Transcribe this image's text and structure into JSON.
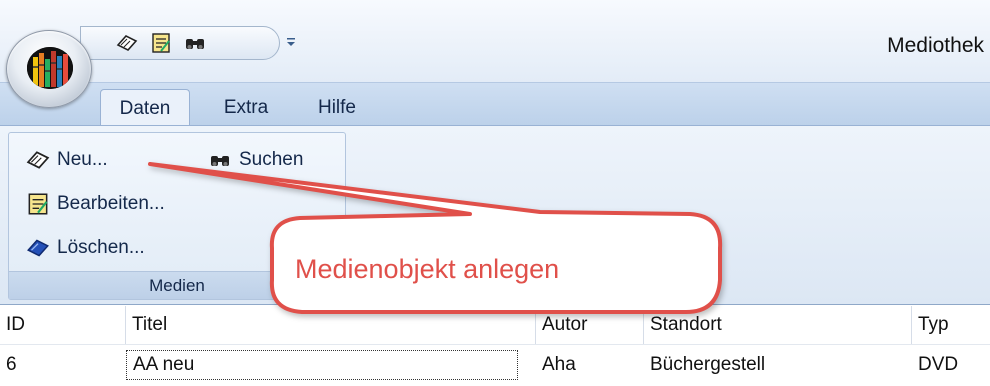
{
  "app": {
    "title": "Mediothek"
  },
  "quick_access": {
    "buttons": [
      {
        "name": "new-media-icon"
      },
      {
        "name": "edit-media-icon"
      },
      {
        "name": "binoculars-icon"
      }
    ],
    "dropdown_glyph": "⩡"
  },
  "tabs": [
    {
      "label": "Daten",
      "active": true
    },
    {
      "label": "Extra",
      "active": false
    },
    {
      "label": "Hilfe",
      "active": false
    }
  ],
  "ribbon": {
    "group_label": "Medien",
    "buttons": {
      "new": "Neu...",
      "edit": "Bearbeiten...",
      "delete": "Löschen...",
      "search": "Suchen"
    }
  },
  "grid": {
    "columns": [
      "ID",
      "Titel",
      "Autor",
      "Standort",
      "Typ"
    ],
    "rows": [
      {
        "id": "6",
        "titel": "AA neu",
        "autor": "Aha",
        "standort": "Büchergestell",
        "typ": "DVD"
      }
    ]
  },
  "callout": {
    "text": "Medienobjekt anlegen"
  },
  "colors": {
    "callout_red": "#e0504a",
    "ribbon_blue": "#dce7f4"
  }
}
